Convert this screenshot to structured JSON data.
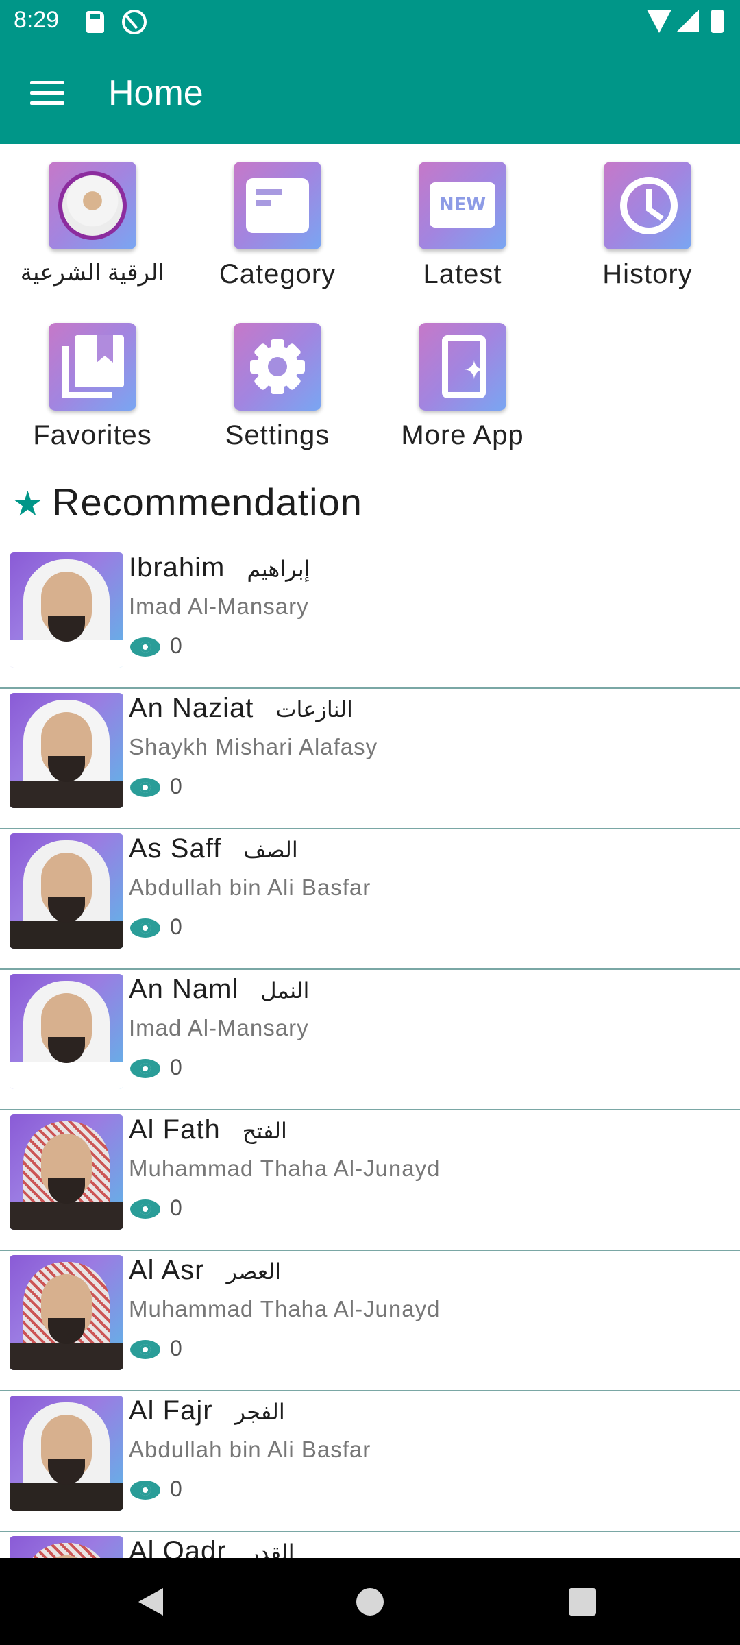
{
  "status_bar": {
    "time": "8:29",
    "icons": [
      "sd-card-icon",
      "a-icon",
      "wifi-icon",
      "signal-icon",
      "battery-icon"
    ]
  },
  "app_bar": {
    "title": "Home",
    "menu_icon": "menu-icon",
    "color": "#009688"
  },
  "shortcuts": [
    {
      "label": "الرقية الشرعية",
      "icon": "ruqya-icon"
    },
    {
      "label": "Category",
      "icon": "category-icon"
    },
    {
      "label": "Latest",
      "icon": "new-icon"
    },
    {
      "label": "History",
      "icon": "history-icon"
    },
    {
      "label": "Favorites",
      "icon": "favorites-icon"
    },
    {
      "label": "Settings",
      "icon": "settings-icon"
    },
    {
      "label": "More App",
      "icon": "more-app-icon"
    }
  ],
  "recommendation": {
    "title": "Recommendation",
    "icon": "star-icon",
    "items": [
      {
        "title": "Ibrahim",
        "title_ar": "إبراهيم",
        "reciter": "Imad Al-Mansary",
        "views": "0"
      },
      {
        "title": "An Naziat",
        "title_ar": "النازعات",
        "reciter": "Shaykh Mishari Alafasy",
        "views": "0"
      },
      {
        "title": "As Saff",
        "title_ar": "الصف",
        "reciter": "Abdullah bin Ali Basfar",
        "views": "0"
      },
      {
        "title": "An Naml",
        "title_ar": "النمل",
        "reciter": "Imad Al-Mansary",
        "views": "0"
      },
      {
        "title": "Al Fath",
        "title_ar": "الفتح",
        "reciter": "Muhammad Thaha Al-Junayd",
        "views": "0"
      },
      {
        "title": "Al Asr",
        "title_ar": "العصر",
        "reciter": "Muhammad Thaha Al-Junayd",
        "views": "0"
      },
      {
        "title": "Al Fajr",
        "title_ar": "الفجر",
        "reciter": "Abdullah bin Ali Basfar",
        "views": "0"
      },
      {
        "title": "Al Qadr",
        "title_ar": "القدر",
        "reciter": "",
        "views": ""
      }
    ]
  },
  "nav_bar": {
    "icons": [
      "back-icon",
      "home-icon",
      "recent-apps-icon"
    ]
  }
}
